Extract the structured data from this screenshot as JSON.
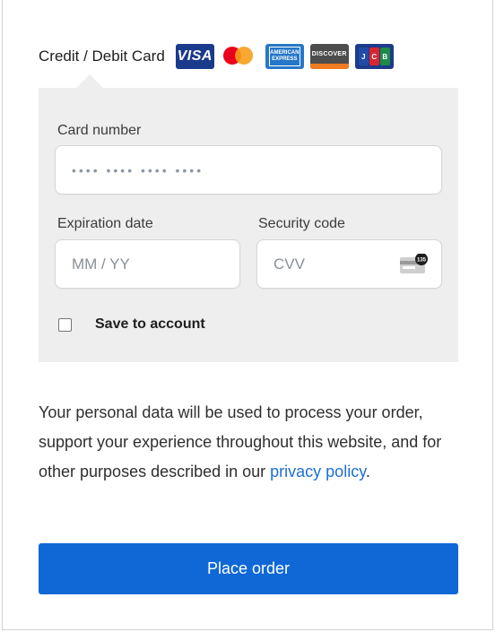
{
  "payment": {
    "method_label": "Credit / Debit Card",
    "card_logos": [
      {
        "name": "visa",
        "text": "VISA",
        "color": "#1a3a8c"
      },
      {
        "name": "mastercard",
        "text": "",
        "color": "#eb001b"
      },
      {
        "name": "amex",
        "text": "AMERICAN EXPRESS",
        "color": "#2677c9"
      },
      {
        "name": "discover",
        "text": "DISCOVER",
        "color": "#4d4d4d"
      },
      {
        "name": "jcb",
        "text": "JCB",
        "color": "#1e3a8a"
      }
    ]
  },
  "form": {
    "card_number_label": "Card number",
    "card_number_placeholder": "•••• •••• •••• ••••",
    "expiration_label": "Expiration date",
    "expiration_placeholder": "MM / YY",
    "security_label": "Security code",
    "security_placeholder": "CVV",
    "cvv_icon_text": "135",
    "save_label": "Save to account",
    "save_checked": false
  },
  "privacy": {
    "text": "Your personal data will be used to process your order, support your experience throughout this website, and for other purposes described in our ",
    "link_text": "privacy policy",
    "suffix": "."
  },
  "actions": {
    "place_order_label": "Place order",
    "accent_color": "#0f68d6"
  }
}
